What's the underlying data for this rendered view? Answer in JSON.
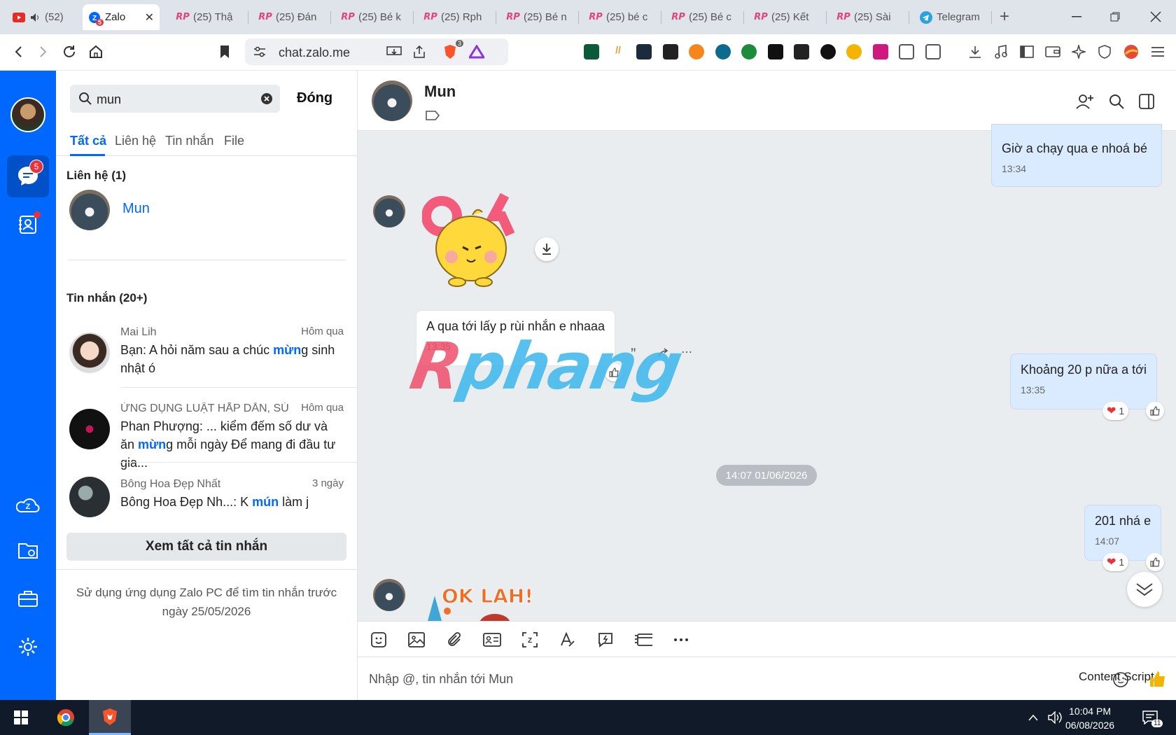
{
  "browser": {
    "tabs": [
      {
        "label": "(52)",
        "icon": "youtube-icon"
      },
      {
        "label": "Zalo",
        "icon": "zalo-icon",
        "badge": "5"
      },
      {
        "label": "(25) Thậ",
        "icon": "rp-icon"
      },
      {
        "label": "(25) Đán",
        "icon": "rp-icon"
      },
      {
        "label": "(25) Bé k",
        "icon": "rp-icon"
      },
      {
        "label": "(25) Rph",
        "icon": "rp-icon"
      },
      {
        "label": "(25) Bé n",
        "icon": "rp-icon"
      },
      {
        "label": "(25) bé c",
        "icon": "rp-icon"
      },
      {
        "label": "(25) Bé c",
        "icon": "rp-icon"
      },
      {
        "label": "(25) Kết",
        "icon": "rp-icon"
      },
      {
        "label": "(25) Sài",
        "icon": "rp-icon"
      },
      {
        "label": "Telegram",
        "icon": "telegram-icon"
      }
    ],
    "url": "chat.zalo.me",
    "brave_badge": "3"
  },
  "rail": {
    "chat_badge": "5"
  },
  "search": {
    "query": "mun",
    "close_label": "Đóng",
    "filter_tabs": [
      "Tất cả",
      "Liên hệ",
      "Tin nhắn",
      "File"
    ],
    "contacts_header": "Liên hệ (1)",
    "contact_name": "Mun",
    "messages_header": "Tin nhắn (20+)",
    "results": [
      {
        "name": "Mai Lih",
        "time": "Hôm qua",
        "pre": "Bạn: A hỏi năm sau a chúc ",
        "hit": "mừn",
        "post": "g sinh nhật ó"
      },
      {
        "name": "ỨNG DỤNG LUẬT HẤP DẪN, SỨ...",
        "time": "Hôm qua",
        "pre": "Phan Phượng: ... kiểm đếm số dư và ăn ",
        "hit": "mừn",
        "post": "g mỗi ngày Để mang đi đầu tư gia..."
      },
      {
        "name": "Bông Hoa Đẹp Nhất",
        "time": "3 ngày",
        "pre": "Bông Hoa Đẹp Nh...: K ",
        "hit": "mún",
        "post": " làm j"
      }
    ],
    "view_all": "Xem tất cả tin nhắn",
    "hint": "Sử dụng ứng dụng Zalo PC để tìm tin nhắn trước ngày 25/05/2026"
  },
  "chat": {
    "name": "Mun",
    "messages": [
      {
        "dir": "out",
        "text": "Giờ a chạy qua e nhoá bé",
        "time": "13:34"
      },
      {
        "dir": "in",
        "sticker": "OK"
      },
      {
        "dir": "in",
        "text": "A qua tới lấy p rùi nhắn e nhaaa",
        "time": "13:35"
      },
      {
        "dir": "out",
        "text": "Khoảng 20 p nữa a tới",
        "time": "13:35",
        "reaction": "1"
      },
      {
        "dir": "out",
        "text": "201 nhá e",
        "time": "14:07",
        "reaction": "1"
      },
      {
        "dir": "in",
        "sticker": "OK LAH!"
      }
    ],
    "date_divider": "14:07 01/06/2026",
    "composer_placeholder": "Nhập @, tin nhắn tới Mun",
    "content_script": "Content Script"
  },
  "watermark": {
    "pre": "R",
    "rest": "phang"
  },
  "taskbar": {
    "time": "10:04 PM",
    "date": "06/08/2026",
    "notif_count": "11"
  },
  "colors": {
    "zalo_blue": "#0068ff",
    "bubble_out": "#dbebff",
    "chat_bg": "#eaedf0"
  }
}
